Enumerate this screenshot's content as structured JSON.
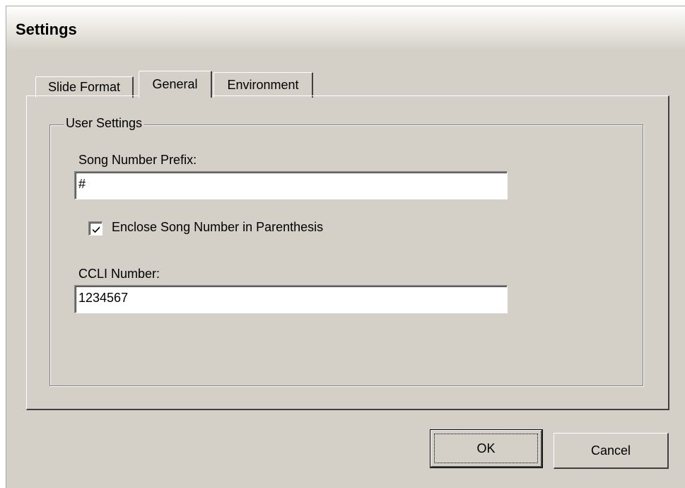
{
  "window": {
    "title": "Settings"
  },
  "tabs": [
    {
      "label": "Slide Format",
      "selected": false
    },
    {
      "label": "General",
      "selected": true
    },
    {
      "label": "Environment",
      "selected": false
    }
  ],
  "group": {
    "legend": "User Settings",
    "song_number_prefix": {
      "label": "Song Number Prefix:",
      "value": "#"
    },
    "enclose_checkbox": {
      "label": "Enclose Song Number in Parenthesis",
      "checked": true
    },
    "ccli_number": {
      "label": "CCLI Number:",
      "value": "1234567"
    }
  },
  "buttons": {
    "ok": "OK",
    "cancel": "Cancel"
  },
  "colors": {
    "face": "#d4d0c8",
    "shadow": "#808080",
    "dark_shadow": "#404040",
    "highlight": "#ffffff"
  }
}
